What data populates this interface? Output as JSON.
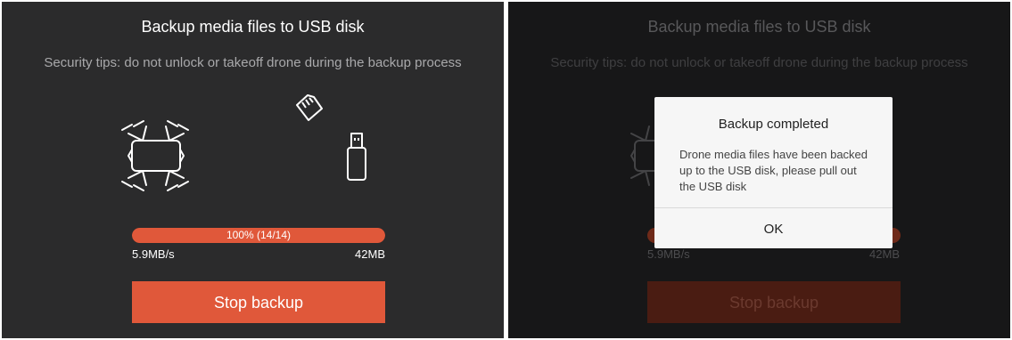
{
  "left": {
    "title": "Backup media files to USB disk",
    "tip": "Security tips: do not unlock or takeoff drone during the backup process",
    "progress": {
      "percent": 100,
      "label": "100% (14/14)",
      "speed": "5.9MB/s",
      "size": "42MB"
    },
    "stop_button": "Stop backup",
    "icons": [
      "drone-icon",
      "sd-card-icon",
      "usb-drive-icon"
    ]
  },
  "right": {
    "title": "Backup media files to USB disk",
    "tip": "Security tips: do not unlock or takeoff drone during the backup process",
    "progress": {
      "speed": "5.9MB/s",
      "size": "42MB"
    },
    "stop_button": "Stop backup",
    "dialog": {
      "title": "Backup completed",
      "message": "Drone media files have been backed up to the USB disk, please pull out the USB disk",
      "ok_button": "OK"
    }
  },
  "colors": {
    "accent": "#e0583a",
    "panel_bg": "#2b2b2c",
    "dimmed_bg": "#171718",
    "dialog_bg": "#f6f6f6"
  }
}
